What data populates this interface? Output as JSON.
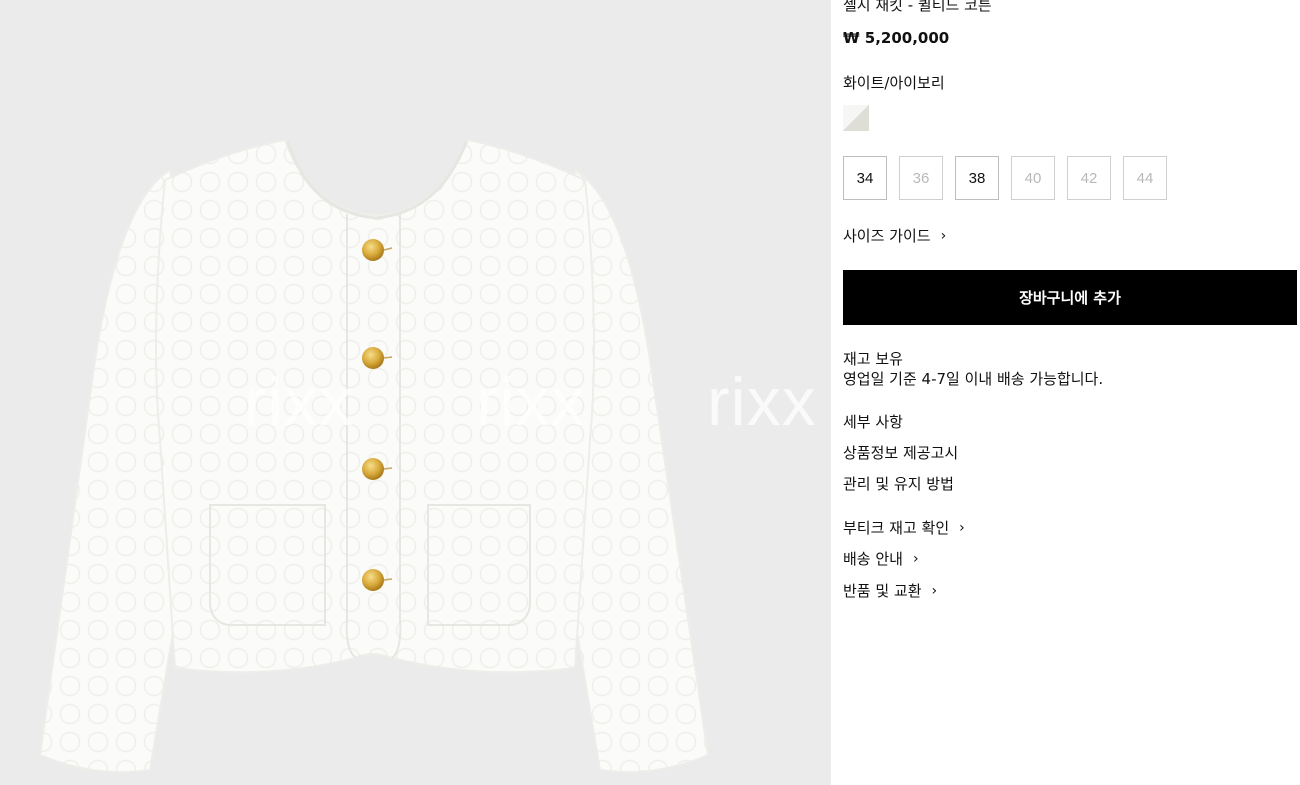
{
  "watermark": {
    "text": "rixx"
  },
  "product": {
    "title": "첼시 재킷 - 퀼티드 코튼",
    "price": "₩ 5,200,000",
    "color_name": "화이트/아이보리",
    "swatch_colors": [
      "#f6f6f4",
      "#deddd6"
    ]
  },
  "sizes": [
    {
      "label": "34",
      "available": true
    },
    {
      "label": "36",
      "available": false
    },
    {
      "label": "38",
      "available": true
    },
    {
      "label": "40",
      "available": false
    },
    {
      "label": "42",
      "available": false
    },
    {
      "label": "44",
      "available": false
    }
  ],
  "size_guide": {
    "label": "사이즈 가이드",
    "icon": "chevron-right-icon"
  },
  "cart_button": {
    "label": "장바구니에 추가"
  },
  "stock": {
    "status": "재고 보유",
    "delivery": "영업일 기준 4-7일 이내 배송 가능합니다."
  },
  "info_links": {
    "details": "세부 사항",
    "product_notice": "상품정보 제공고시",
    "care": "관리 및 유지 방법"
  },
  "service_links": {
    "boutique_stock": "부티크 재고 확인",
    "shipping": "배송 안내",
    "returns": "반품 및 교환",
    "icon": "chevron-right-icon"
  },
  "colors": {
    "accent": "#000000",
    "background": "#ebebeb",
    "jacket": "#fbfbf9",
    "button_gold": "#d8a93a"
  }
}
